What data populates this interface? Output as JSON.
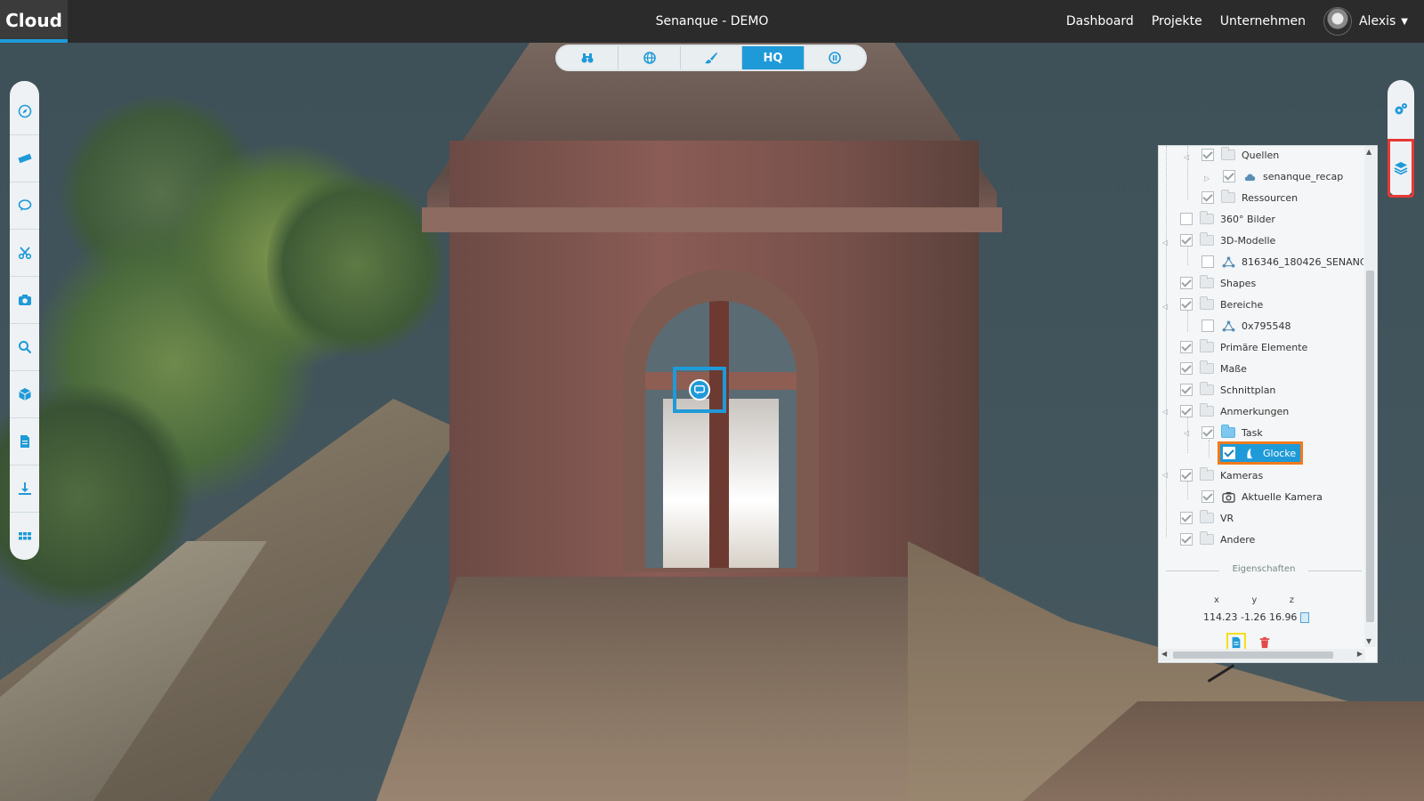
{
  "app": {
    "brand": "Cloud",
    "project_title": "Senanque - DEMO"
  },
  "nav": {
    "links": [
      "Dashboard",
      "Projekte",
      "Unternehmen"
    ],
    "user_name": "Alexis"
  },
  "top_toolbar": {
    "buttons": [
      "binoculars-icon",
      "globe-icon",
      "brush-icon",
      "HQ",
      "pause-icon"
    ],
    "active": "HQ"
  },
  "left_toolbar": {
    "buttons": [
      "compass-icon",
      "ruler-icon",
      "comment-icon",
      "scissors-icon",
      "camera-icon",
      "search-icon",
      "cube-icon",
      "document-icon",
      "download-icon",
      "grid-icon"
    ]
  },
  "right_toolbar": {
    "buttons": [
      "settings-icon",
      "layers-icon"
    ],
    "highlighted": "layers-icon"
  },
  "layers": {
    "items": [
      {
        "label": "Quellen",
        "checked": true,
        "icon": "folder"
      },
      {
        "label": "senanque_recap",
        "checked": true,
        "icon": "cloud"
      },
      {
        "label": "Ressourcen",
        "checked": true,
        "icon": "folder"
      },
      {
        "label": "360° Bilder",
        "checked": false,
        "icon": "folder"
      },
      {
        "label": "3D-Modelle",
        "checked": true,
        "icon": "folder"
      },
      {
        "label": "816346_180426_SENANC",
        "checked": false,
        "icon": "mesh"
      },
      {
        "label": "Shapes",
        "checked": true,
        "icon": "folder"
      },
      {
        "label": "Bereiche",
        "checked": true,
        "icon": "folder"
      },
      {
        "label": "0x795548",
        "checked": false,
        "icon": "mesh"
      },
      {
        "label": "Primäre Elemente",
        "checked": true,
        "icon": "folder"
      },
      {
        "label": "Maße",
        "checked": true,
        "icon": "folder"
      },
      {
        "label": "Schnittplan",
        "checked": true,
        "icon": "folder"
      },
      {
        "label": "Anmerkungen",
        "checked": true,
        "icon": "folder"
      },
      {
        "label": "Task",
        "checked": true,
        "icon": "folder-blue"
      },
      {
        "label": "Glocke",
        "checked": true,
        "icon": "note",
        "selected": true
      },
      {
        "label": "Kameras",
        "checked": true,
        "icon": "folder"
      },
      {
        "label": "Aktuelle Kamera",
        "checked": true,
        "icon": "camera"
      },
      {
        "label": "VR",
        "checked": true,
        "icon": "folder"
      },
      {
        "label": "Andere",
        "checked": true,
        "icon": "folder"
      }
    ]
  },
  "properties": {
    "heading": "Eigenschaften",
    "coord_labels": [
      "x",
      "y",
      "z"
    ],
    "coords_text": "114.23 -1.26 16.96"
  },
  "colors": {
    "accent": "#1f9ad8",
    "selected_outline": "#f07b1d",
    "highlight_red": "#e53935",
    "highlight_yellow": "#f4e01a",
    "delete_red": "#e24a4a"
  }
}
